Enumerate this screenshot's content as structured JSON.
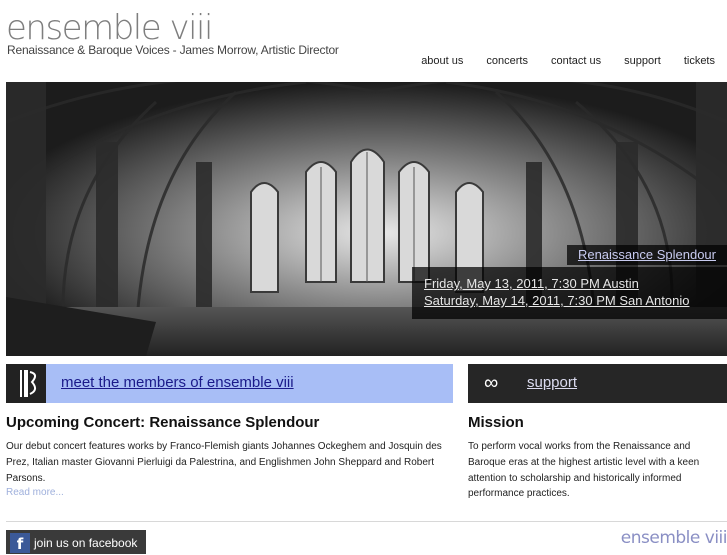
{
  "header": {
    "logo_text": "ensemble viii",
    "tagline": "Renaissance & Baroque Voices - James Morrow, Artistic Director"
  },
  "nav": {
    "items": [
      "about us",
      "concerts",
      "contact us",
      "support",
      "tickets"
    ]
  },
  "hero": {
    "event_title": "Renaissance Splendour",
    "dates": [
      "Friday, May 13, 2011, 7:30 PM Austin",
      "Saturday, May 14, 2011, 7:30 PM San Antonio"
    ]
  },
  "members_bar": {
    "icon": "members-glyph",
    "link": "meet the members of ensemble viii"
  },
  "support_bar": {
    "icon": "infinity-icon",
    "link": "support"
  },
  "concert": {
    "heading": "Upcoming Concert: Renaissance Splendour",
    "body": "Our debut concert features works by Franco-Flemish giants Johannes Ockeghem and Josquin des Prez, Italian master Giovanni Pierluigi da Palestrina, and Englishmen John Sheppard and Robert Parsons.",
    "read_more": "Read more..."
  },
  "mission": {
    "heading": "Mission",
    "body": "To perform vocal works from the Renaissance and Baroque eras at the highest artistic level with a keen attention to scholarship and historically informed performance practices."
  },
  "footer": {
    "facebook_label": "join us on facebook",
    "facebook_icon": "f",
    "logo_text": "ensemble viii"
  },
  "colors": {
    "members_bar": "#a8bef6",
    "support_bar": "#262626",
    "logo_gray": "#7e7e7e",
    "link_blue": "#1a1a8a"
  }
}
